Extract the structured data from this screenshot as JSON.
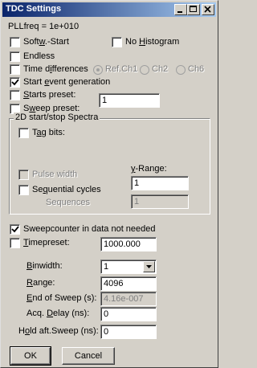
{
  "window": {
    "title": "TDC Settings",
    "title_gradient_start": "#0a246a",
    "title_gradient_end": "#a6caf0",
    "face_color": "#d4d0c8"
  },
  "pllfreq_label": "PLLfreq = 1e+010",
  "softw_start": {
    "pre": "Soft",
    "u": "w",
    "post": ".-Start",
    "checked": false
  },
  "no_histogram": {
    "pre": "No ",
    "u": "H",
    "post": "istogram",
    "checked": false
  },
  "endless": {
    "label": "Endless",
    "checked": false
  },
  "time_differences": {
    "pre": "Time d",
    "u": "i",
    "post": "fferences",
    "checked": false
  },
  "radios": [
    {
      "label": "Ref.Ch1"
    },
    {
      "label": "Ch2"
    },
    {
      "label": "Ch6"
    }
  ],
  "start_event": {
    "pre": "Start ",
    "u": "e",
    "post": "vent generation",
    "checked": true
  },
  "starts_preset": {
    "pre": "",
    "u": "S",
    "post": "tarts preset:",
    "checked": false,
    "value": "1"
  },
  "sweep_preset": {
    "pre": "S",
    "u": "w",
    "post": "eep preset:",
    "checked": false
  },
  "spectra_group": {
    "title": "2D start/stop Spectra",
    "tag_bits": {
      "pre": "T",
      "u": "a",
      "post": "g bits:",
      "checked": false
    },
    "y_range_label": {
      "pre": "",
      "u": "y",
      "post": "-Range:"
    },
    "pulse_width": {
      "label": "Pulse width",
      "checked": false
    },
    "y_range_value": "1",
    "sequential_cycles": {
      "pre": "Se",
      "u": "q",
      "post": "uential cycles",
      "checked": false
    },
    "sequences_label": "Sequences",
    "sequences_value": "1"
  },
  "sweepcounter": {
    "label": "Sweepcounter in data not needed",
    "checked": true
  },
  "timepreset": {
    "pre": "",
    "u": "T",
    "post": "imepreset:",
    "checked": false,
    "value": "1000.000"
  },
  "binwidth": {
    "pre": "",
    "u": "B",
    "post": "inwidth:",
    "value": "1"
  },
  "range": {
    "pre": "",
    "u": "R",
    "post": "ange:",
    "value": "4096"
  },
  "end_of_sweep": {
    "pre": "",
    "u": "E",
    "post": "nd of Sweep (s):",
    "value": "4.16e-007"
  },
  "acq_delay": {
    "pre": "Acq. ",
    "u": "D",
    "post": "elay (ns):",
    "value": "0"
  },
  "hold_aft_sweep": {
    "pre": "H",
    "u": "o",
    "post": "ld aft.Sweep (ns):",
    "value": "0"
  },
  "buttons": {
    "ok": "OK",
    "cancel": "Cancel"
  },
  "titlebar_buttons": [
    "minimize-icon",
    "maximize-icon",
    "close-icon"
  ]
}
